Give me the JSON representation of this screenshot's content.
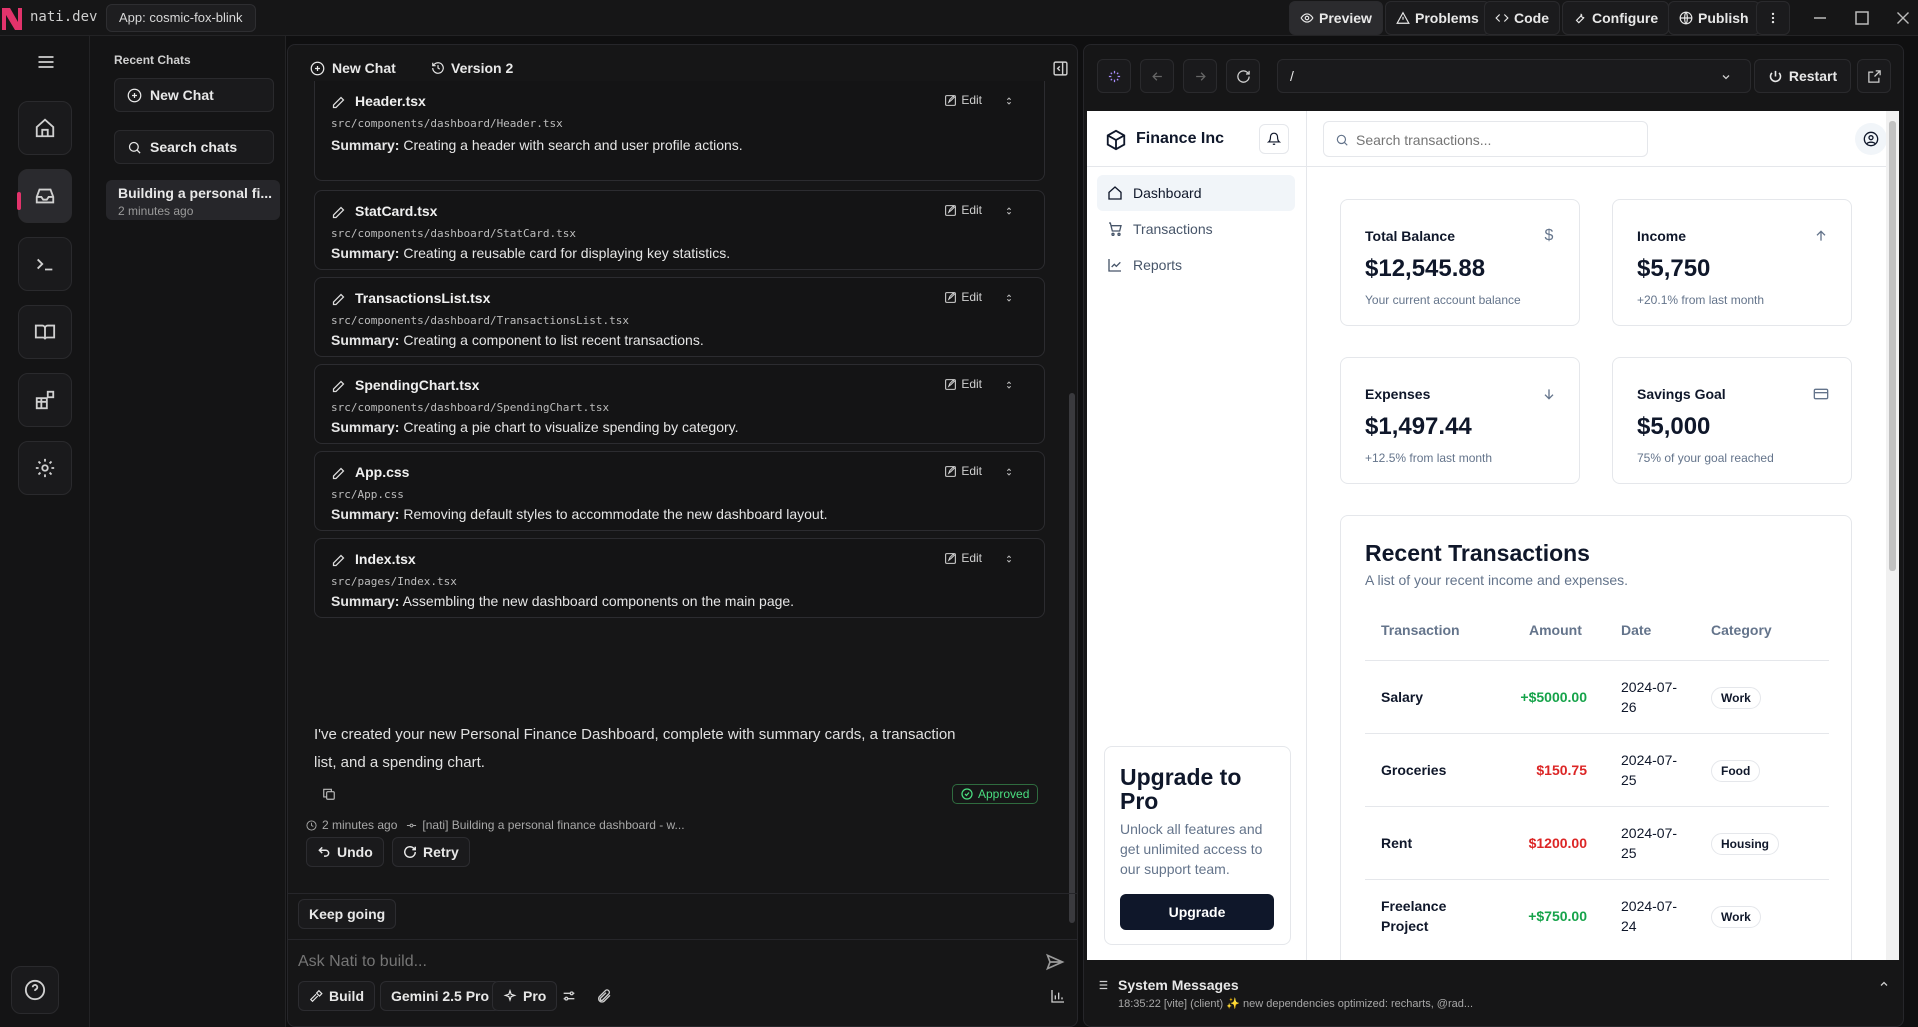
{
  "titlebar": {
    "brand": "nati.dev",
    "app_tag": "App: cosmic-fox-blink",
    "buttons": [
      "Preview",
      "Problems",
      "Code",
      "Configure",
      "Publish"
    ]
  },
  "chatlist": {
    "heading": "Recent Chats",
    "new_chat": "New Chat",
    "search": "Search chats",
    "items": [
      {
        "title": "Building a personal fi...",
        "time": "2 minutes ago"
      }
    ]
  },
  "chat": {
    "new_chat": "New Chat",
    "version": "Version 2",
    "edit_label": "Edit",
    "summary_prefix": "Summary:",
    "files": [
      {
        "name": "Header.tsx",
        "path": "src/components/dashboard/Header.tsx",
        "summary": "Creating a header with search and user profile actions."
      },
      {
        "name": "StatCard.tsx",
        "path": "src/components/dashboard/StatCard.tsx",
        "summary": "Creating a reusable card for displaying key statistics."
      },
      {
        "name": "TransactionsList.tsx",
        "path": "src/components/dashboard/TransactionsList.tsx",
        "summary": "Creating a component to list recent transactions."
      },
      {
        "name": "SpendingChart.tsx",
        "path": "src/components/dashboard/SpendingChart.tsx",
        "summary": "Creating a pie chart to visualize spending by category."
      },
      {
        "name": "App.css",
        "path": "src/App.css",
        "summary": "Removing default styles to accommodate the new dashboard layout."
      },
      {
        "name": "Index.tsx",
        "path": "src/pages/Index.tsx",
        "summary": "Assembling the new dashboard components on the main page."
      }
    ],
    "message_line1": "I've created your new Personal Finance Dashboard, complete with summary cards, a transaction",
    "message_line2": "list, and a spending chart.",
    "approved": "Approved",
    "meta_time": "2 minutes ago",
    "meta_commit": "[nati] Building a personal finance dashboard - w...",
    "undo": "Undo",
    "retry": "Retry",
    "keep_going": "Keep going",
    "input_placeholder": "Ask Nati to build...",
    "bottom": {
      "build": "Build",
      "model": "Gemini 2.5 Pro",
      "pro": "Pro"
    }
  },
  "preview": {
    "url": "/",
    "restart": "Restart"
  },
  "app": {
    "brand": "Finance Inc",
    "search_placeholder": "Search transactions...",
    "nav": [
      "Dashboard",
      "Transactions",
      "Reports"
    ],
    "stats": [
      {
        "label": "Total Balance",
        "value": "$12,545.88",
        "sub": "Your current account balance",
        "icon": "dollar-icon"
      },
      {
        "label": "Income",
        "value": "$5,750",
        "sub": "+20.1% from last month",
        "icon": "arrow-up-icon"
      },
      {
        "label": "Expenses",
        "value": "$1,497.44",
        "sub": "+12.5% from last month",
        "icon": "arrow-down-icon"
      },
      {
        "label": "Savings Goal",
        "value": "$5,000",
        "sub": "75% of your goal reached",
        "icon": "credit-card-icon"
      }
    ],
    "transactions": {
      "title": "Recent Transactions",
      "subtitle": "A list of your recent income and expenses.",
      "headers": [
        "Transaction",
        "Amount",
        "Date",
        "Category"
      ],
      "rows": [
        {
          "name": "Salary",
          "amount": "+$5000.00",
          "date1": "2024-07-",
          "date2": "26",
          "category": "Work",
          "kind": "pos"
        },
        {
          "name": "Groceries",
          "amount": "$150.75",
          "date1": "2024-07-",
          "date2": "25",
          "category": "Food",
          "kind": "neg"
        },
        {
          "name": "Rent",
          "amount": "$1200.00",
          "date1": "2024-07-",
          "date2": "25",
          "category": "Housing",
          "kind": "neg"
        },
        {
          "name1": "Freelance",
          "name2": "Project",
          "amount": "+$750.00",
          "date1": "2024-07-",
          "date2": "24",
          "category": "Work",
          "kind": "pos"
        }
      ]
    },
    "upgrade": {
      "title_line1": "Upgrade to",
      "title_line2": "Pro",
      "text_line1": "Unlock all features and",
      "text_line2": "get unlimited access to",
      "text_line3": "our support team.",
      "button": "Upgrade"
    }
  },
  "system": {
    "title": "System Messages",
    "line": "18:35:22 [vite] (client) ✨ new dependencies optimized: recharts, @rad..."
  },
  "colors": {
    "accent": "#e2336b",
    "positive": "#16a34a",
    "negative": "#dc2626",
    "approved": "#22c55e"
  }
}
